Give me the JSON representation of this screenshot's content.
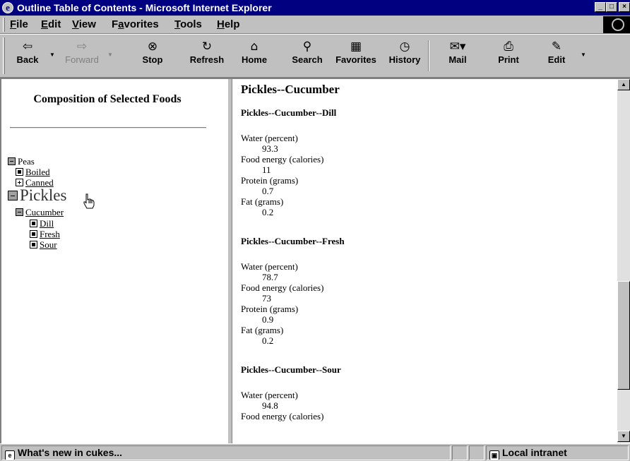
{
  "window": {
    "title": "Outline Table of Contents - Microsoft Internet Explorer",
    "icon": "ie-logo-icon",
    "controls": [
      "minimize",
      "maximize",
      "close"
    ]
  },
  "menu": [
    {
      "label": "File",
      "accel": "F"
    },
    {
      "label": "Edit",
      "accel": "E"
    },
    {
      "label": "View",
      "accel": "V"
    },
    {
      "label": "Favorites",
      "accel": "a"
    },
    {
      "label": "Tools",
      "accel": "T"
    },
    {
      "label": "Help",
      "accel": "H"
    }
  ],
  "toolbar": {
    "back": {
      "label": "Back",
      "icon": "back-arrow-icon"
    },
    "forward": {
      "label": "Forward",
      "icon": "forward-arrow-icon",
      "disabled": true
    },
    "stop": {
      "label": "Stop",
      "icon": "stop-icon"
    },
    "refresh": {
      "label": "Refresh",
      "icon": "refresh-icon"
    },
    "home": {
      "label": "Home",
      "icon": "home-icon"
    },
    "search": {
      "label": "Search",
      "icon": "search-icon"
    },
    "favorites": {
      "label": "Favorites",
      "icon": "favorites-icon"
    },
    "history": {
      "label": "History",
      "icon": "history-icon"
    },
    "mail": {
      "label": "Mail",
      "icon": "mail-icon"
    },
    "print": {
      "label": "Print",
      "icon": "print-icon"
    },
    "edit": {
      "label": "Edit",
      "icon": "edit-icon"
    }
  },
  "toc": {
    "title": "Composition of Selected Foods",
    "nodes": {
      "peas": "Peas",
      "boiled": "Boiled",
      "canned": "Canned",
      "pickles": "Pickles",
      "cucumber": "Cucumber",
      "dill": "Dill",
      "fresh": "Fresh",
      "sour": "Sour"
    }
  },
  "content": {
    "heading": "Pickles--Cucumber",
    "sections": [
      {
        "title": "Pickles--Cucumber--Dill",
        "rows": [
          {
            "label": "Water (percent)",
            "value": "93.3"
          },
          {
            "label": "Food energy (calories)",
            "value": "11"
          },
          {
            "label": "Protein (grams)",
            "value": "0.7"
          },
          {
            "label": "Fat (grams)",
            "value": "0.2"
          }
        ]
      },
      {
        "title": "Pickles--Cucumber--Fresh",
        "rows": [
          {
            "label": "Water (percent)",
            "value": "78.7"
          },
          {
            "label": "Food energy (calories)",
            "value": "73"
          },
          {
            "label": "Protein (grams)",
            "value": "0.9"
          },
          {
            "label": "Fat (grams)",
            "value": "0.2"
          }
        ]
      },
      {
        "title": "Pickles--Cucumber--Sour",
        "rows": [
          {
            "label": "Water (percent)",
            "value": "94.8"
          },
          {
            "label": "Food energy (calories)",
            "value": ""
          }
        ]
      }
    ]
  },
  "status": {
    "text": "What's new in cukes...",
    "zone": "Local intranet"
  },
  "colors": {
    "titlebar": "#000080",
    "chrome": "#c0c0c0",
    "page_background": "#ffffff"
  }
}
